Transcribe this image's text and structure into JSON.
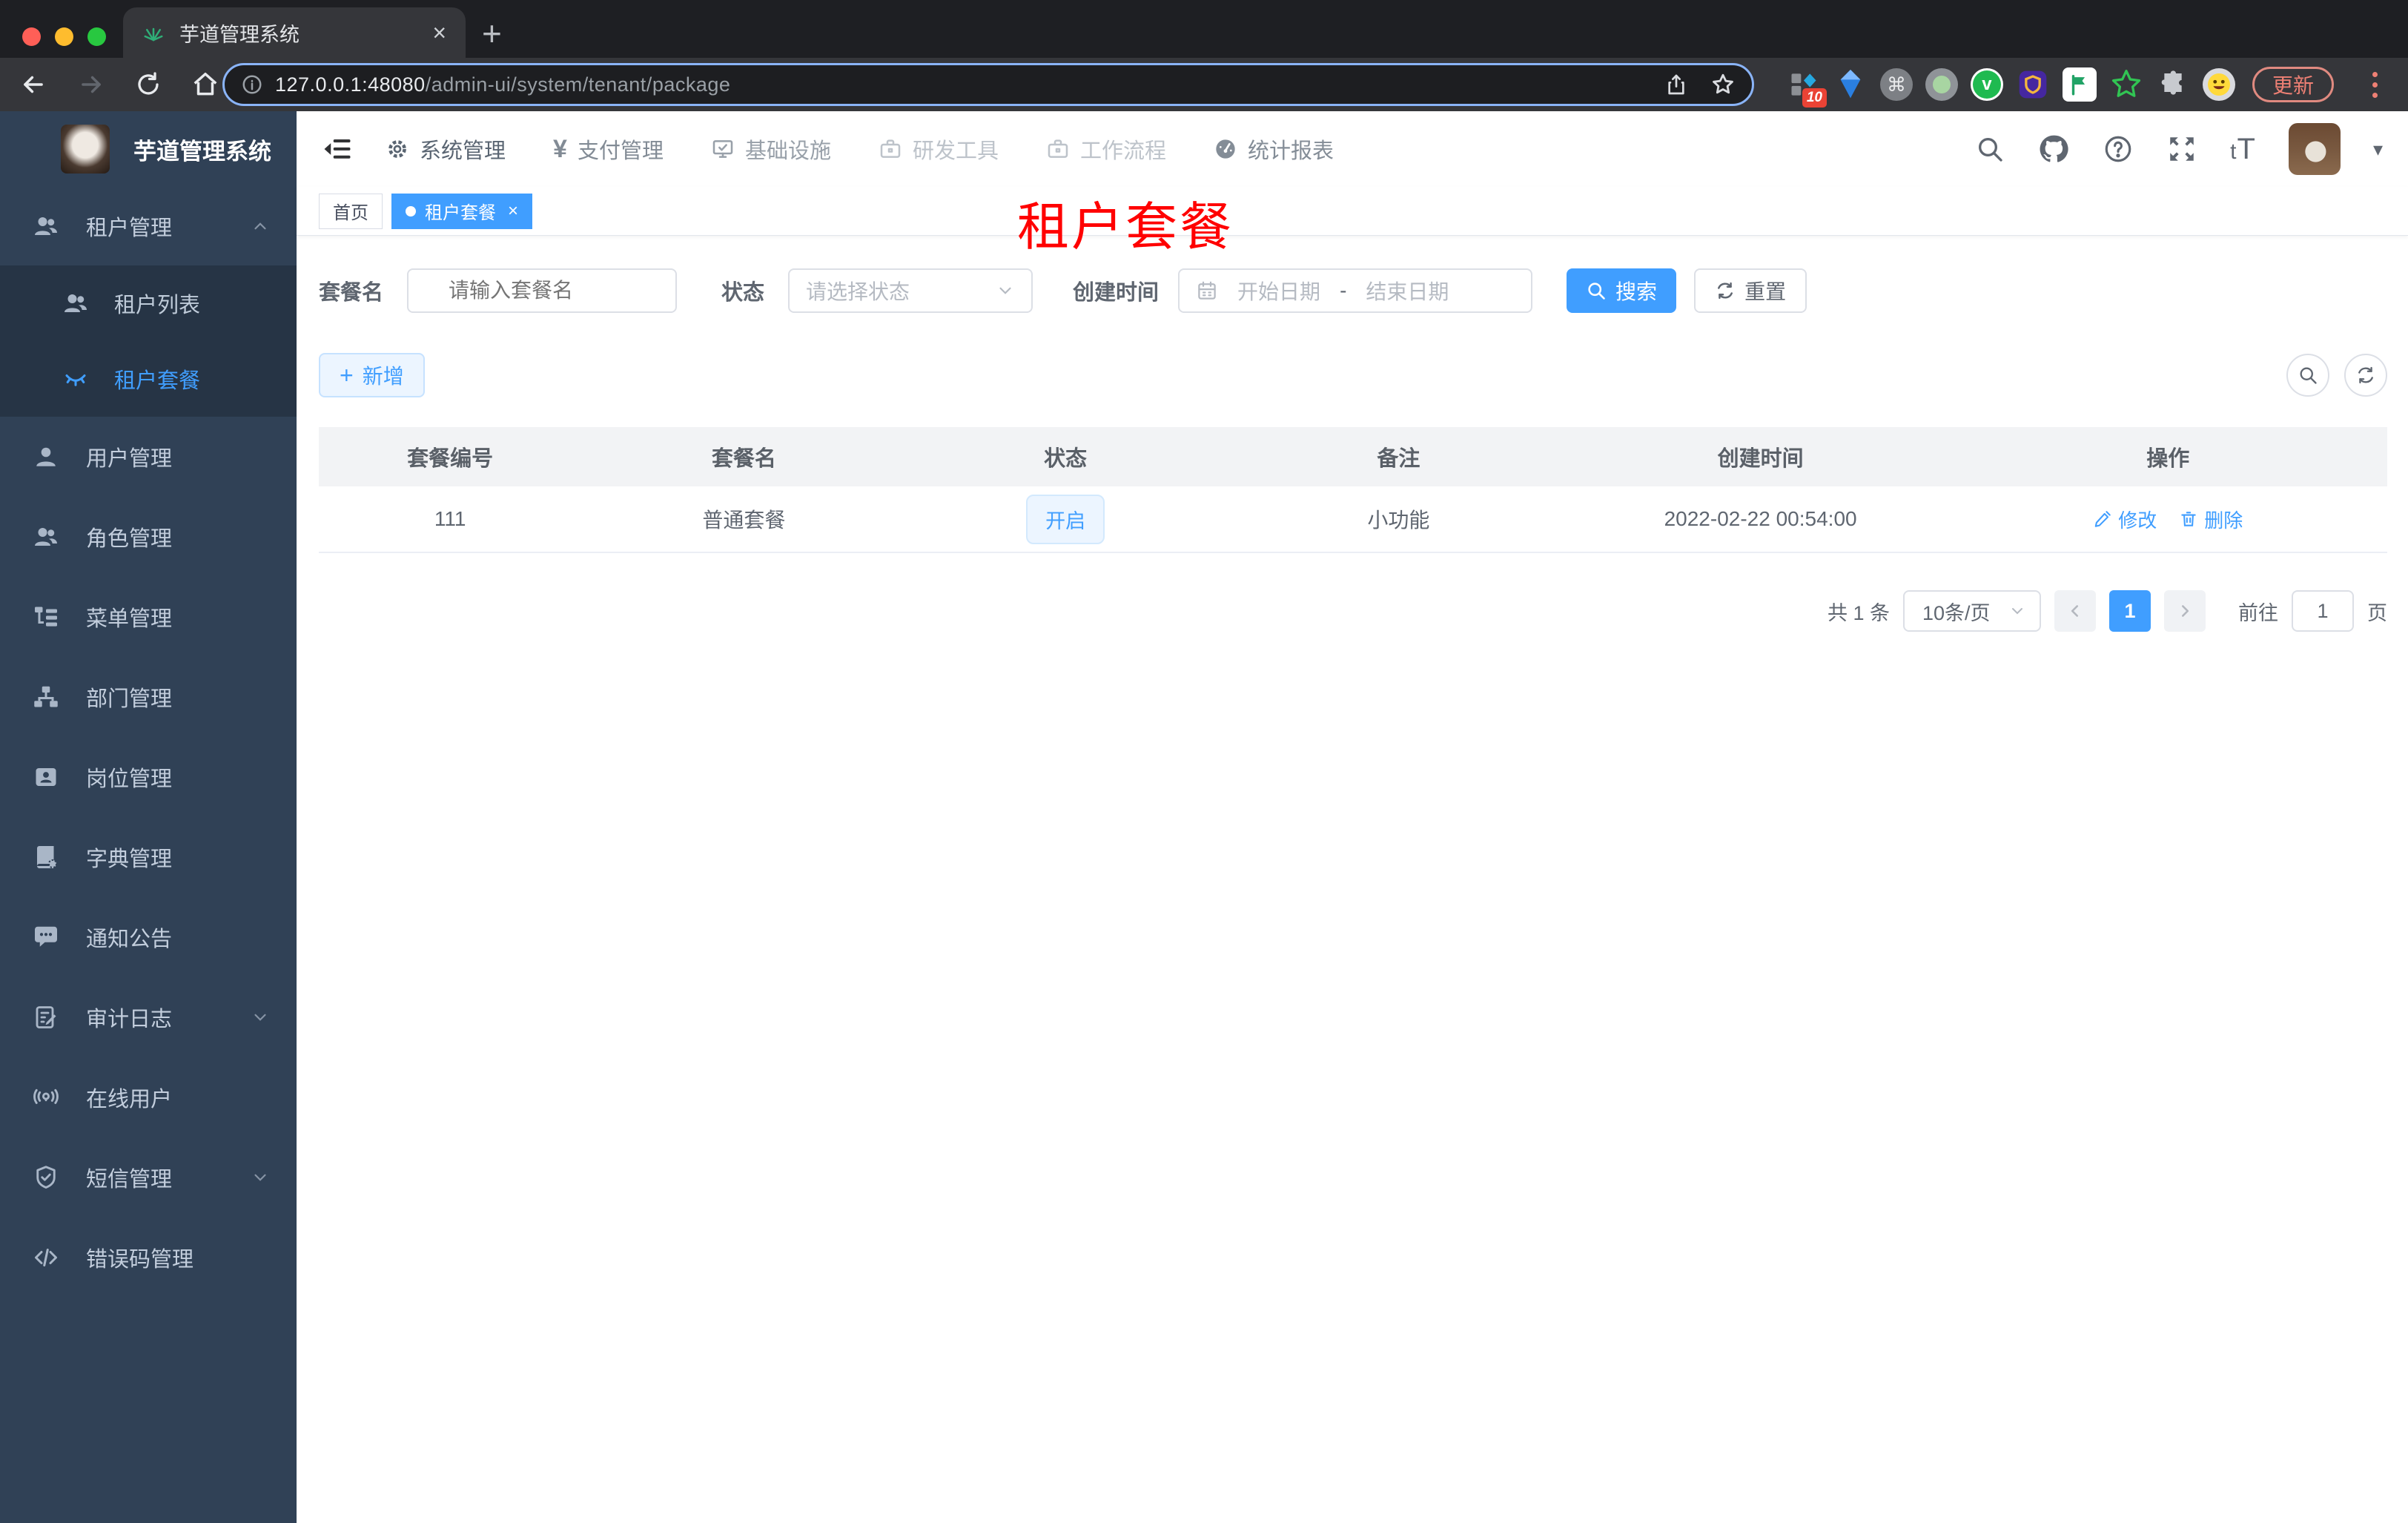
{
  "browser": {
    "tab_title": "芋道管理系统",
    "new_tab": "+",
    "close_tab": "×",
    "url_host": "127.0.0.1:48080",
    "url_path": "/admin-ui/system/tenant/package",
    "ext_badge": "10",
    "update_label": "更新"
  },
  "sidebar": {
    "app_title": "芋道管理系统",
    "group": {
      "label": "租户管理"
    },
    "sub": [
      {
        "label": "租户列表"
      },
      {
        "label": "租户套餐"
      }
    ],
    "items": [
      {
        "label": "用户管理"
      },
      {
        "label": "角色管理"
      },
      {
        "label": "菜单管理"
      },
      {
        "label": "部门管理"
      },
      {
        "label": "岗位管理"
      },
      {
        "label": "字典管理"
      },
      {
        "label": "通知公告"
      },
      {
        "label": "审计日志"
      },
      {
        "label": "在线用户"
      },
      {
        "label": "短信管理"
      },
      {
        "label": "错误码管理"
      }
    ]
  },
  "topnav": {
    "items": [
      {
        "label": "系统管理"
      },
      {
        "label": "支付管理"
      },
      {
        "label": "基础设施"
      },
      {
        "label": "研发工具"
      },
      {
        "label": "工作流程"
      },
      {
        "label": "统计报表"
      }
    ],
    "font_size_icon": "tT"
  },
  "tags": {
    "items": [
      {
        "label": "首页"
      },
      {
        "label": "租户套餐",
        "close": "×"
      }
    ]
  },
  "overlay": {
    "title": "租户套餐"
  },
  "filters": {
    "name_label": "套餐名",
    "name_placeholder": "请输入套餐名",
    "status_label": "状态",
    "status_placeholder": "请选择状态",
    "time_label": "创建时间",
    "start_placeholder": "开始日期",
    "range_separator": "-",
    "end_placeholder": "结束日期",
    "search_label": "搜索",
    "reset_label": "重置"
  },
  "toolbar": {
    "add_icon": "+",
    "add_label": "新增"
  },
  "table": {
    "headers": [
      "套餐编号",
      "套餐名",
      "状态",
      "备注",
      "创建时间",
      "操作"
    ],
    "rows": [
      {
        "id": "111",
        "name": "普通套餐",
        "status": "开启",
        "remark": "小功能",
        "created": "2022-02-22 00:54:00",
        "edit_label": "修改",
        "delete_label": "删除"
      }
    ]
  },
  "pagination": {
    "total": "共 1 条",
    "page_size": "10条/页",
    "current": "1",
    "goto_label": "前往",
    "goto_value": "1",
    "page_unit": "页"
  },
  "colors": {
    "accent": "#409eff",
    "overlay_red": "#ff0000",
    "sidebar_bg": "#304156"
  }
}
